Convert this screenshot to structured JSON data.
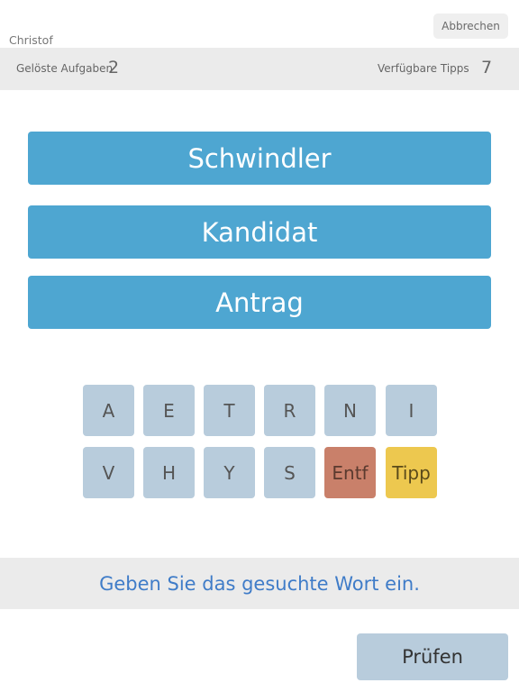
{
  "header": {
    "username": "Christof",
    "cancel_label": "Abbrechen"
  },
  "status": {
    "solved_label": "Gelöste Aufgaben",
    "solved_value": "2",
    "tips_label": "Verfügbare Tipps",
    "tips_value": "7"
  },
  "words": [
    "Schwindler",
    "Kandidat",
    "Antrag"
  ],
  "keyboard": {
    "row1": [
      "A",
      "E",
      "T",
      "R",
      "N",
      "I"
    ],
    "row2": [
      "V",
      "H",
      "Y",
      "S"
    ],
    "delete_label": "Entf",
    "hint_label": "Tipp"
  },
  "message": "Geben Sie das gesuchte Wort ein.",
  "check_label": "Prüfen",
  "colors": {
    "word_button": "#4ea6d1",
    "key": "#b8ccdc",
    "delete_key": "#c9806a",
    "hint_key": "#edc84f",
    "message_text": "#3f7cc8"
  }
}
